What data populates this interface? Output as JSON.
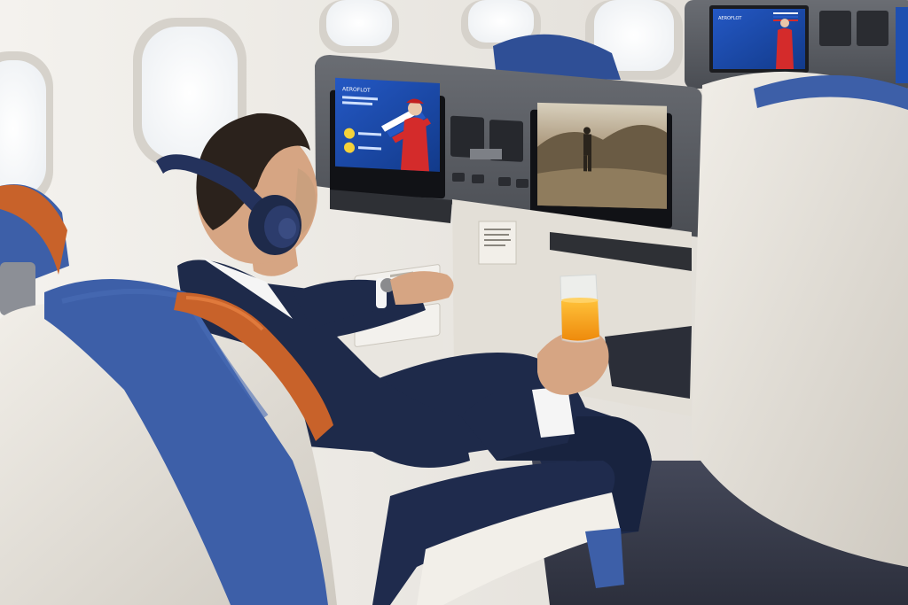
{
  "photo": {
    "subject": "business-class-cabin-passenger",
    "colors": {
      "cabin_wall": "#ece9e3",
      "seat_shell": "#e4e0d8",
      "seat_blue": "#3d5fa8",
      "seat_orange": "#c8622a",
      "console_gray": "#5a5d63",
      "suit_navy": "#1e2a4a",
      "juice_orange": "#f5a31a",
      "screen_blue": "#1f4fb0",
      "uniform_red": "#d42b2b",
      "carpet": "#3b3f52"
    },
    "icons": {
      "screen_left": "airline-welcome-screen",
      "screen_right": "movie-landscape-screen",
      "screen_top_right": "airline-welcome-screen",
      "headphones": "headphones-icon",
      "glass": "juice-glass-icon"
    }
  }
}
